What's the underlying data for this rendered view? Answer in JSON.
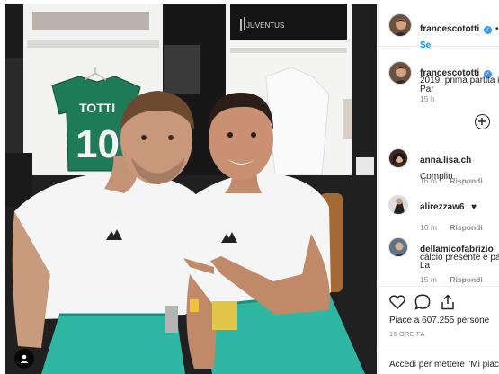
{
  "photo": {
    "jersey_name": "TOTTI",
    "jersey_number": "10",
    "locker_brand": "JUVENTUS"
  },
  "post": {
    "author": "francescototti",
    "follow_label": "Se",
    "caption_line1": "Par",
    "caption_line2": "2019, prima partita in",
    "caption_time": "15 h"
  },
  "comments": [
    {
      "user": "anna.lisa.ch",
      "text": "Complin",
      "time": "16 m",
      "reply": "Rispondi"
    },
    {
      "user": "alirezzaw6",
      "text": "",
      "time": "16 m",
      "reply": "Rispondi"
    },
    {
      "user": "dellamicofabrizio",
      "text": "La",
      "text_line2": "calcio presente e pas",
      "time": "15 m",
      "reply": "Rispondi"
    }
  ],
  "actions": {
    "likes": "Piace a 607.255 persone",
    "time_ago": "15 ORE FA",
    "add_comment_placeholder": "Accedi per mettere \"Mi piac"
  },
  "icons": {
    "verified": "verified-badge-icon",
    "like": "heart-icon",
    "comment": "comment-bubble-icon",
    "share": "share-icon",
    "more": "plus-circle-icon",
    "tag": "user-tag-icon"
  },
  "colors": {
    "accent": "#0095f6",
    "verified": "#3897f0",
    "teal_shorts": "#2fb7a4"
  }
}
